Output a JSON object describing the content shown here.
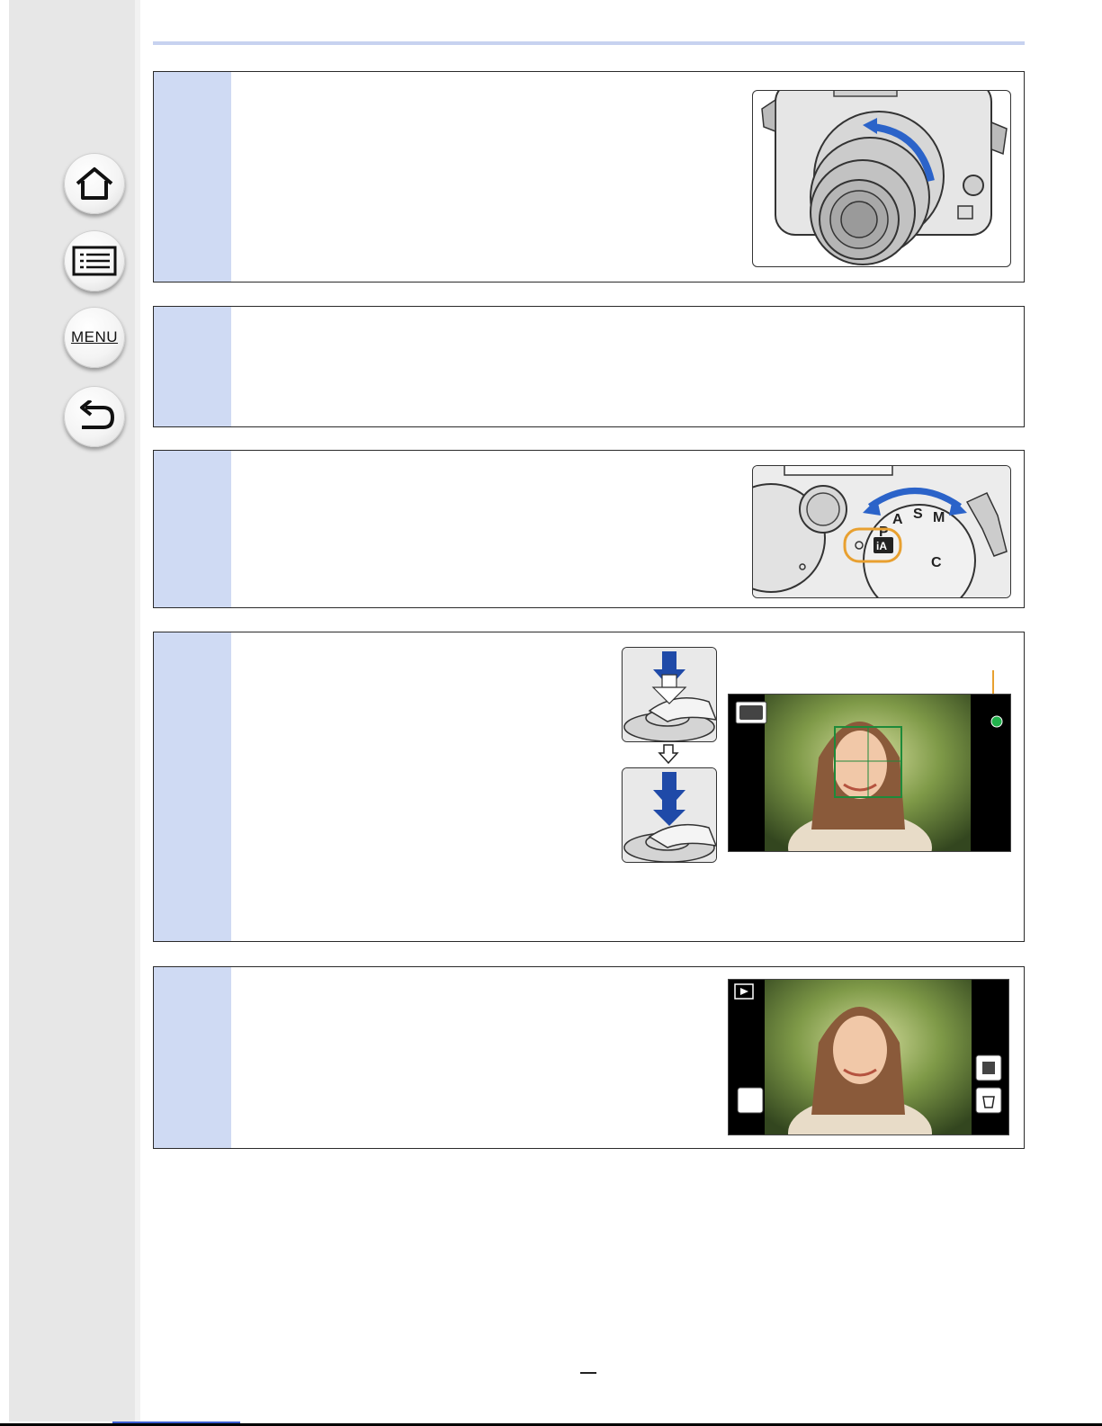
{
  "nav": {
    "home_icon": "home-icon",
    "contents_icon": "contents-list-icon",
    "menu_label": "MENU",
    "back_icon": "back-arrow-icon"
  },
  "steps": [
    {
      "id": 1,
      "figure": "camera-lens-zoom-ring-illustration"
    },
    {
      "id": 2
    },
    {
      "id": 3,
      "figure": "mode-dial-illustration",
      "dial_labels": [
        "P",
        "A",
        "S",
        "M",
        "C",
        "iA"
      ]
    },
    {
      "id": 4,
      "figure": "shutter-button-press-illustration"
    },
    {
      "id": 5,
      "figure": "playback-screen-illustration"
    }
  ],
  "colors": {
    "step_number_bg": "#cfdaf3",
    "header_rule": "#c7d2f0",
    "focus_frame": "#1e8a3a",
    "focus_indicator": "#22b14c",
    "dial_highlight": "#e8a030",
    "arrow_blue": "#2b63c9"
  }
}
